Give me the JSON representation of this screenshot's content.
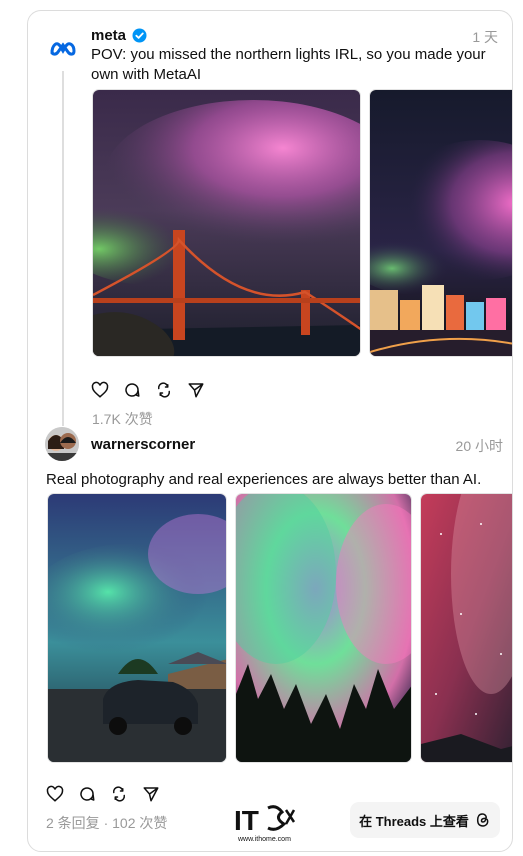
{
  "post1": {
    "username": "meta",
    "timestamp": "1 天",
    "text": "POV: you missed the northern lights IRL, so you made your own with MetaAI",
    "likes": "1.7K 次赞",
    "images": [
      {
        "subject": "golden-gate-aurora"
      },
      {
        "subject": "city-skyline-aurora"
      }
    ]
  },
  "post2": {
    "username": "warnerscorner",
    "timestamp": "20 小时",
    "text": "Real photography and real experiences are always better than AI.",
    "stats": "2 条回复 · 102 次赞",
    "images": [
      {
        "subject": "house-car-aurora"
      },
      {
        "subject": "trees-aurora-sky"
      },
      {
        "subject": "milky-way-red-sky"
      }
    ]
  },
  "footer": {
    "threads_button": "在 Threads 上查看",
    "watermark_brand": "IT之家",
    "watermark_url": "www.ithome.com"
  },
  "icons": [
    "meta-logo-icon",
    "verified-icon",
    "heart-icon",
    "comment-icon",
    "repost-icon",
    "share-icon",
    "threads-logo-icon"
  ],
  "colors": {
    "verified": "#0095f6",
    "meta_blue": "#0668E1",
    "muted_text": "#999999"
  }
}
